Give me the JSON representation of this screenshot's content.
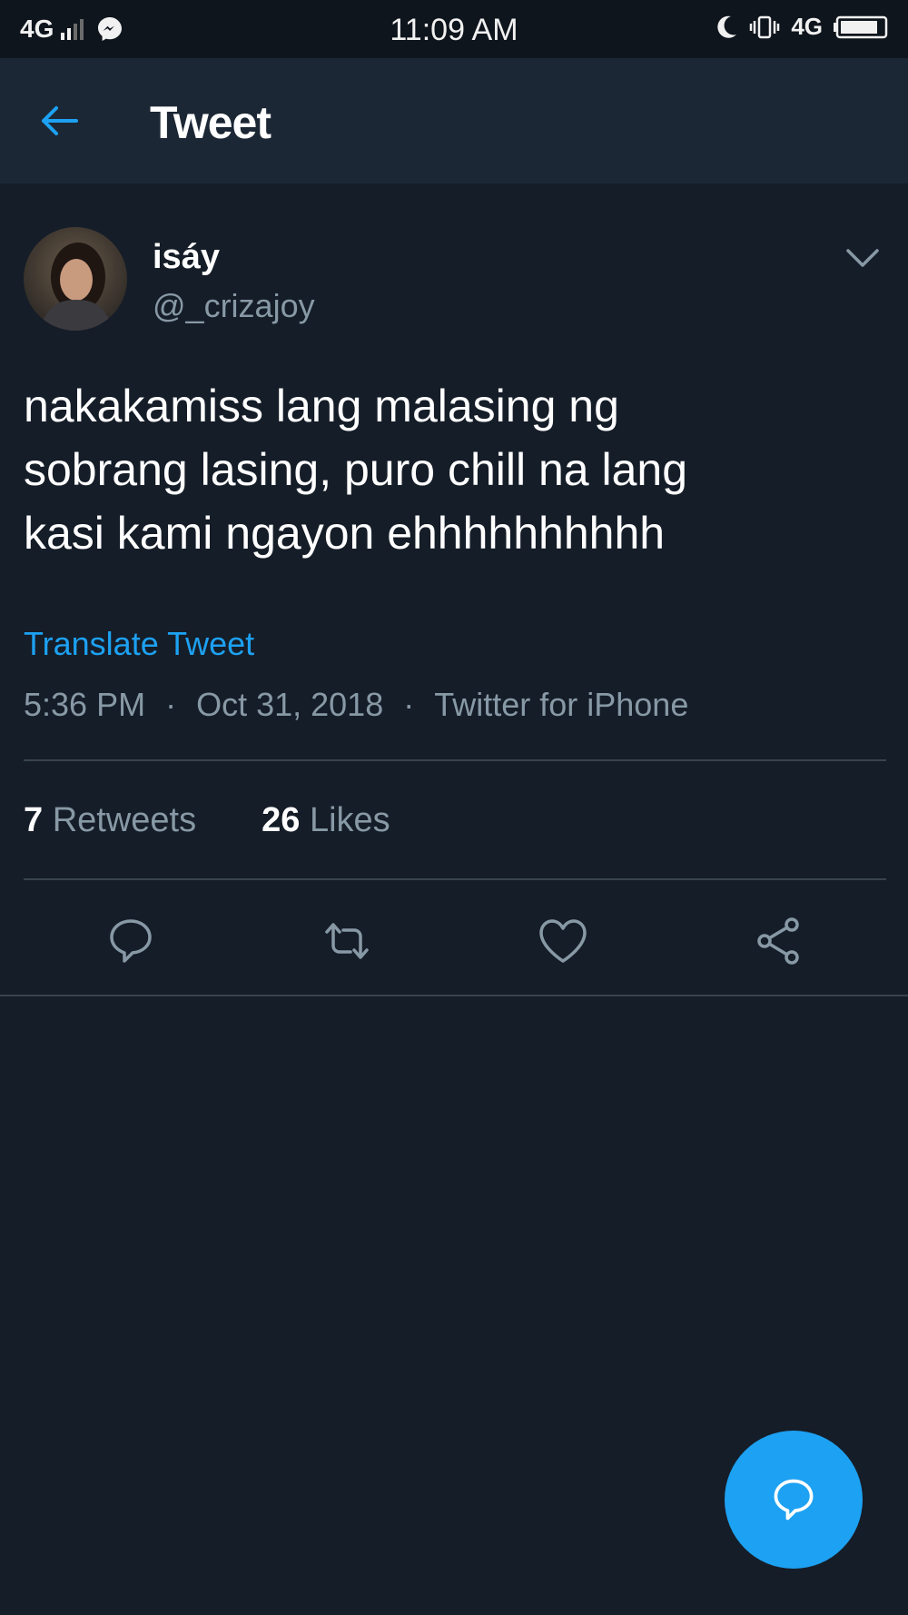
{
  "status_bar": {
    "network_left": "4G",
    "time": "11:09 AM",
    "network_right": "4G"
  },
  "nav": {
    "title": "Tweet"
  },
  "tweet": {
    "display_name": "isáy",
    "handle": "@_crizajoy",
    "text_lines": [
      "nakakamiss lang malasing ng",
      "sobrang lasing, puro chill na lang",
      "kasi kami ngayon ehhhhhhhhhh"
    ],
    "translate_label": "Translate Tweet",
    "time": "5:36 PM",
    "separator": "·",
    "date": "Oct 31, 2018",
    "client": "Twitter for iPhone",
    "retweets_count": "7",
    "retweets_label": "Retweets",
    "likes_count": "26",
    "likes_label": "Likes"
  },
  "icons": {
    "back": "arrow-left-icon",
    "more": "chevron-down-icon",
    "reply": "reply-icon",
    "retweet": "retweet-icon",
    "like": "heart-icon",
    "share": "share-icon",
    "compose": "compose-reply-icon"
  },
  "colors": {
    "background": "#151d28",
    "nav_background": "#1c2735",
    "accent": "#1da1f2",
    "secondary_text": "#8899a6",
    "divider": "#38444d"
  }
}
